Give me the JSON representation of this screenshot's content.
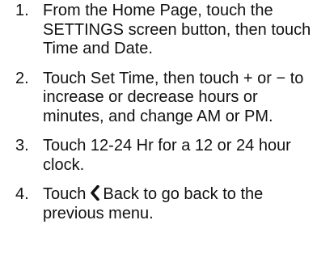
{
  "steps": [
    {
      "number": "1.",
      "text": "From the Home Page, touch the SETTINGS screen button, then touch Time and Date."
    },
    {
      "number": "2.",
      "text": "Touch Set Time, then touch + or − to increase or decrease hours or minutes, and change AM or PM."
    },
    {
      "number": "3.",
      "text": "Touch 12-24 Hr for a 12 or 24 hour clock."
    },
    {
      "number": "4.",
      "text_before_icon": "Touch",
      "icon": "back-chevron-icon",
      "text_after_icon": "Back to go back to the previous menu."
    }
  ]
}
